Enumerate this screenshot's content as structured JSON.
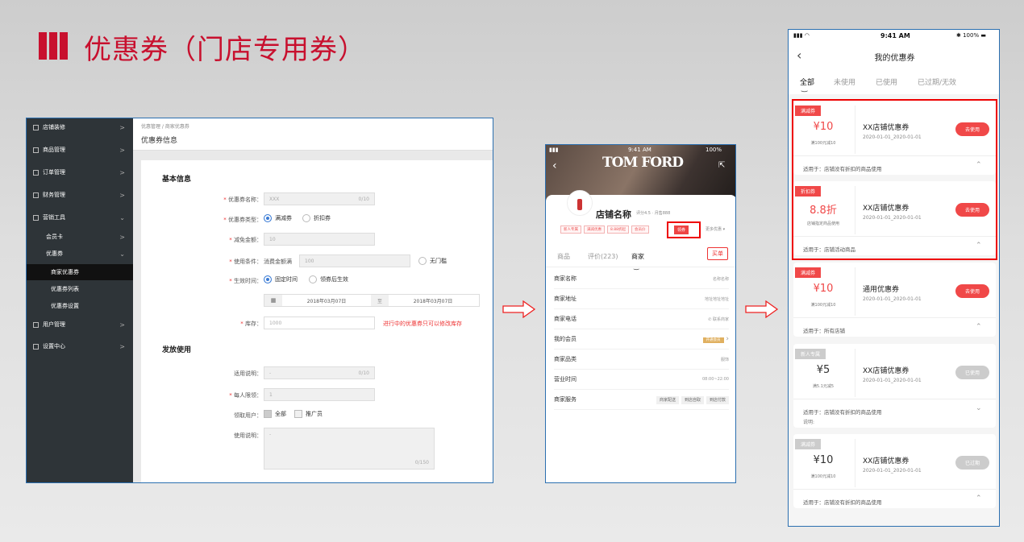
{
  "title": "优惠券（门店专用券）",
  "colors": {
    "accent": "#c8102e",
    "coupon_red": "#f04848",
    "disabled": "#cccccc"
  },
  "admin": {
    "sidebar": [
      {
        "label": "店铺装修",
        "chev": ">"
      },
      {
        "label": "商品管理",
        "chev": ">"
      },
      {
        "label": "订单管理",
        "chev": ">"
      },
      {
        "label": "财务管理",
        "chev": ">"
      },
      {
        "label": "营销工具",
        "chev": "⌄"
      },
      {
        "label": "会员卡",
        "chev": ">"
      },
      {
        "label": "优惠券",
        "chev": "⌄"
      },
      {
        "label": "商家优惠券",
        "chev": ""
      },
      {
        "label": "优惠券列表",
        "chev": ""
      },
      {
        "label": "优惠券设置",
        "chev": ""
      },
      {
        "label": "用户管理",
        "chev": ">"
      },
      {
        "label": "设置中心",
        "chev": ">"
      }
    ],
    "breadcrumb": "优惠管理 / 商家优惠券",
    "page_title": "优惠券信息",
    "section1": "基本信息",
    "f_name": {
      "label": "优惠券名称：",
      "placeholder": "XXX",
      "count": "0/10"
    },
    "f_type": {
      "label": "优惠券类型：",
      "opt1": "满减券",
      "opt2": "折扣券"
    },
    "f_reduce": {
      "label": "减免金额：",
      "value": "10"
    },
    "f_cond": {
      "label": "使用条件：",
      "prefix": "消费金额满",
      "value": "100",
      "opt": "无门槛"
    },
    "f_time": {
      "label": "生效时间：",
      "opt1": "固定时间",
      "opt2": "领券后生效",
      "start": "2018年03月07日",
      "to": "至",
      "end": "2018年03月07日"
    },
    "f_stock": {
      "label": "库存：",
      "value": "1000",
      "warn": "进行中的优惠券只可以修改库存"
    },
    "section2": "发放使用",
    "f_desc": {
      "label": "适用说明：",
      "placeholder": "-",
      "count": "0/10"
    },
    "f_limit": {
      "label": "每人限领：",
      "value": "1"
    },
    "f_user": {
      "label": "领取用户：",
      "opt1": "全部",
      "opt2": "推广员"
    },
    "f_usage": {
      "label": "使用说明：",
      "placeholder": "-",
      "count": "0/150"
    }
  },
  "shop": {
    "time": "9:41 AM",
    "battery": "100%",
    "brand": "TOM FORD",
    "name": "店铺名称",
    "rating": "评分4.5 · 月售888",
    "tags": [
      "新人专属",
      "满减优惠",
      "8.88折起",
      "会员价"
    ],
    "coupon_tag": "领券",
    "more": "更多优惠",
    "tabs": [
      "商品",
      "评价(223)",
      "商家"
    ],
    "buy": "买单",
    "rows": [
      {
        "k": "商家名称",
        "v": "名称名称"
      },
      {
        "k": "商家地址",
        "v": "地址地址地址"
      },
      {
        "k": "商家电话",
        "v": "联系商家"
      },
      {
        "k": "我的会员",
        "v": "开通会员"
      },
      {
        "k": "商家品类",
        "v": "服饰"
      },
      {
        "k": "营业时间",
        "v": "08:00~22:00"
      },
      {
        "k": "商家服务",
        "chips": [
          "商家配送",
          "到店自取",
          "到店付款"
        ]
      }
    ]
  },
  "coupons_page": {
    "time": "9:41 AM",
    "battery": "100%",
    "title": "我的优惠券",
    "tabs": [
      "全部",
      "未使用",
      "已使用",
      "已过期/无效"
    ],
    "coupons": [
      {
        "badge": "满减券",
        "amount": "¥10",
        "cond": "满100元减10",
        "name": "XX店铺优惠券",
        "date": "2020-01-01_2020-01-01",
        "btn": "去使用",
        "apply": "适用于：店铺没有折扣的商品使用",
        "note": "",
        "active": true
      },
      {
        "badge": "折扣券",
        "amount": "8.8折",
        "cond": "店铺指定商品使用",
        "name": "XX店铺优惠券",
        "date": "2020-01-01_2020-01-01",
        "btn": "去使用",
        "apply": "适用于：店铺活动商品",
        "note": "",
        "active": true
      },
      {
        "badge": "满减券",
        "amount": "¥10",
        "cond": "满100元减10",
        "name": "通用优惠券",
        "date": "2020-01-01_2020-01-01",
        "btn": "去使用",
        "apply": "适用于：所有店铺",
        "note": "",
        "active": true
      },
      {
        "badge": "新人专属",
        "amount": "¥5",
        "cond": "满5.1元减5",
        "name": "XX店铺优惠券",
        "date": "2020-01-01_2020-01-01",
        "btn": "已使用",
        "apply": "适用于：店铺没有折扣的商品使用",
        "note": "说明:",
        "active": false
      },
      {
        "badge": "满减券",
        "amount": "¥10",
        "cond": "满100元减10",
        "name": "XX店铺优惠券",
        "date": "2020-01-01_2020-01-01",
        "btn": "已过期",
        "apply": "适用于：店铺没有折扣的商品使用",
        "note": "",
        "active": false
      }
    ]
  }
}
